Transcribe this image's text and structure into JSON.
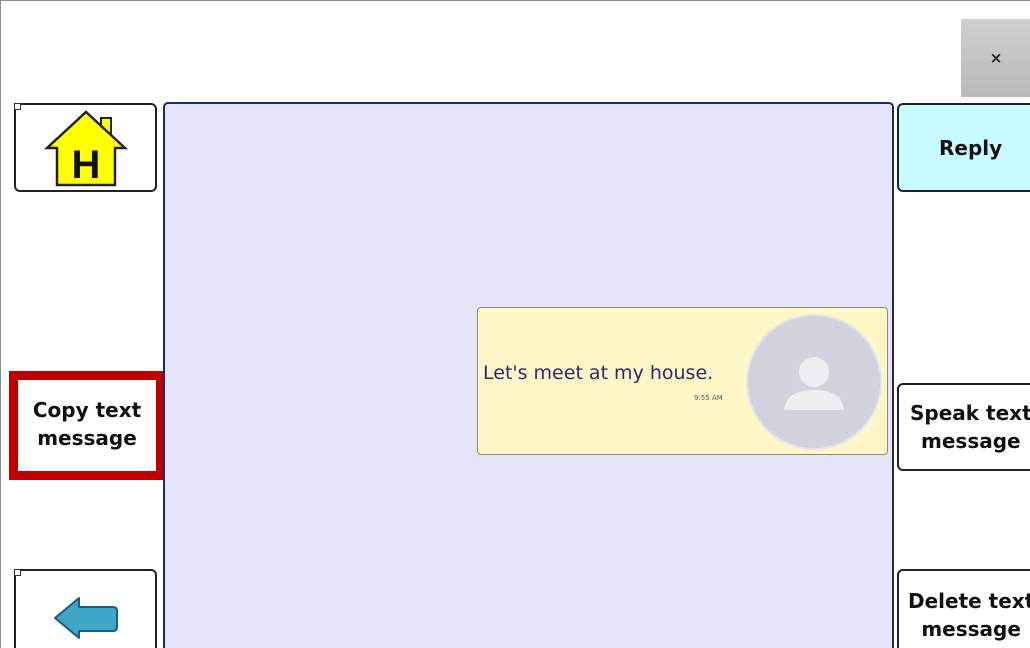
{
  "window": {
    "close_label": "×"
  },
  "left_column": {
    "home_icon": "house-icon",
    "home_letter": "H",
    "copy_line1": "Copy text",
    "copy_line2": "message",
    "back_icon": "left-arrow-icon"
  },
  "right_column": {
    "reply_label": "Reply",
    "speak_line1": "Speak text",
    "speak_line2": "message",
    "delete_line1": "Delete text",
    "delete_line2": "message"
  },
  "conversation": {
    "messages": [
      {
        "text": "Let's meet at my house.",
        "time": "9:55 AM",
        "avatar": "person-silhouette-icon"
      }
    ]
  },
  "colors": {
    "home_fill": "#ffff00",
    "back_arrow_fill": "#3ea6c6",
    "reply_background": "#c8fbff",
    "selection_border": "#c00000",
    "panel_background": "#e4e4f8",
    "bubble_background": "#fdf7c8"
  }
}
